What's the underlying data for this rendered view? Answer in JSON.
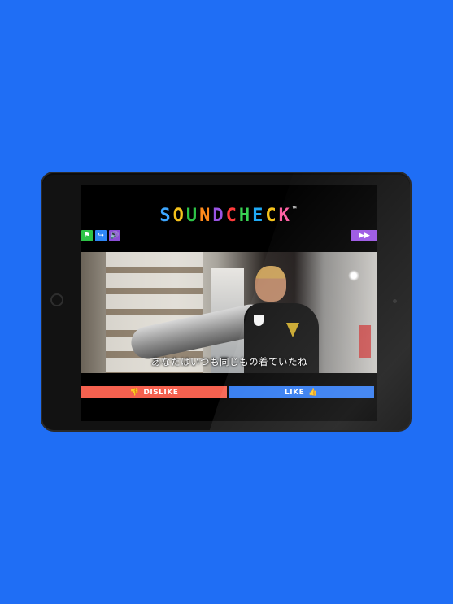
{
  "app": {
    "logo_letters": [
      "S",
      "O",
      "U",
      "N",
      "D",
      "C",
      "H",
      "E",
      "C",
      "K"
    ],
    "logo_colors": [
      "#3da6ff",
      "#f5c21b",
      "#2ec447",
      "#ff8a1c",
      "#9a54e3",
      "#ff3b3b",
      "#39d353",
      "#1fa9f5",
      "#f5c21b",
      "#ff5fa2"
    ],
    "logo_tm": "™"
  },
  "controls": {
    "flag_icon": "flag-icon",
    "share_icon": "share-icon",
    "sound_icon": "speaker-icon",
    "skip_icon": "fast-forward-icon",
    "colors": {
      "flag": "#2ec447",
      "share": "#2e86f5",
      "sound": "#8a4ed6",
      "skip": "#9a54e3"
    }
  },
  "video": {
    "subtitle": "あなたはいつも同じもの着ていたね"
  },
  "vote": {
    "dislike_label": "DISLIKE",
    "like_label": "LIKE",
    "dislike_color": "#f5614f",
    "like_color": "#2e78f0"
  }
}
